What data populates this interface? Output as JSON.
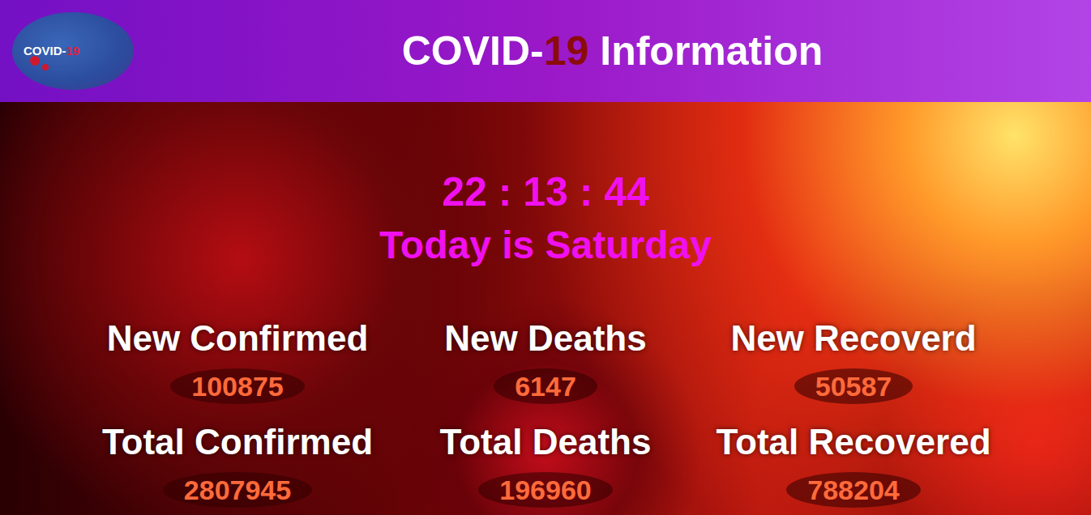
{
  "logo": {
    "parts": [
      "COVID-",
      "19"
    ]
  },
  "title": {
    "parts": [
      "COVID-",
      "19",
      " Information"
    ]
  },
  "clock": {
    "time": "22 : 13 : 44",
    "day": "Today is Saturday"
  },
  "stats": [
    {
      "label": "New Confirmed",
      "value": "100875"
    },
    {
      "label": "New Deaths",
      "value": "6147"
    },
    {
      "label": "New Recoverd",
      "value": "50587"
    },
    {
      "label": "Total Confirmed",
      "value": "2807945"
    },
    {
      "label": "Total Deaths",
      "value": "196960"
    },
    {
      "label": "Total Recovered",
      "value": "788204"
    }
  ]
}
